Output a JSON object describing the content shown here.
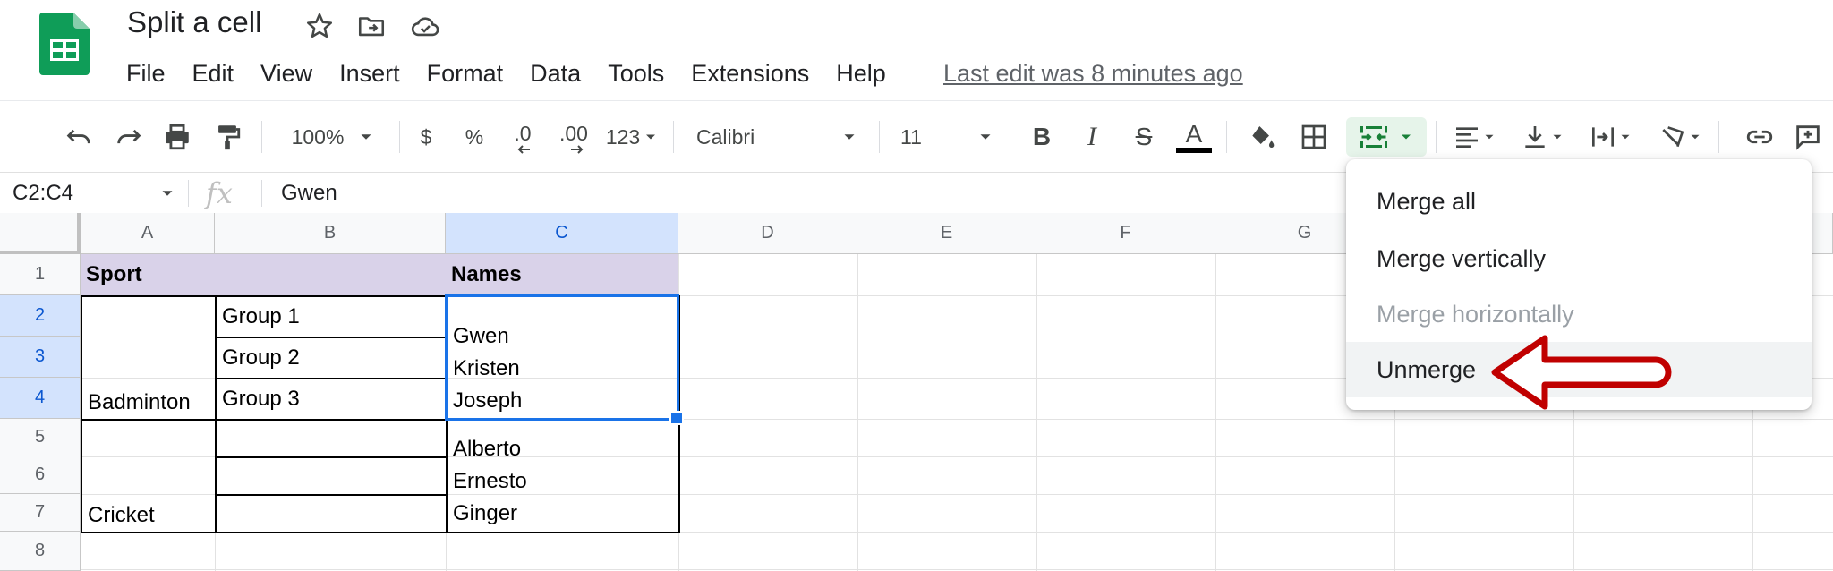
{
  "document": {
    "title": "Split a cell",
    "last_edit": "Last edit was 8 minutes ago"
  },
  "menu": [
    "File",
    "Edit",
    "View",
    "Insert",
    "Format",
    "Data",
    "Tools",
    "Extensions",
    "Help"
  ],
  "toolbar": {
    "zoom": "100%",
    "currency": "$",
    "percent": "%",
    "decrease_decimal": ".0",
    "increase_decimal": ".00",
    "number_format": "123",
    "font": "Calibri",
    "font_size": "11",
    "bold": "B",
    "italic": "I",
    "strikethrough": "S",
    "text_color": "A",
    "accent_color": "#188038",
    "text_color_bar": "#000000"
  },
  "formula_bar": {
    "name_box": "C2:C4",
    "fx": "fx",
    "value": "Gwen"
  },
  "grid": {
    "columns": [
      "A",
      "B",
      "C",
      "D",
      "E",
      "F",
      "G"
    ],
    "rows": [
      "1",
      "2",
      "3",
      "4",
      "5",
      "6",
      "7",
      "8"
    ],
    "header_fill": "#d9d2e9",
    "cells": {
      "a1": "Sport",
      "c1": "Names",
      "b2": "Group 1",
      "b3": "Group 2",
      "b4": "Group 3",
      "a4": "Badminton",
      "c2_line1": "Gwen",
      "c2_line2": "Kristen",
      "c2_line3": "Joseph",
      "a7": "Cricket",
      "c5_line1": "Alberto",
      "c5_line2": "Ernesto",
      "c5_line3": "Ginger"
    }
  },
  "merge_menu": {
    "items": [
      {
        "label": "Merge all",
        "state": "enabled"
      },
      {
        "label": "Merge vertically",
        "state": "enabled"
      },
      {
        "label": "Merge horizontally",
        "state": "disabled"
      },
      {
        "label": "Unmerge",
        "state": "highlighted"
      }
    ],
    "arrow_color": "#c00000"
  }
}
